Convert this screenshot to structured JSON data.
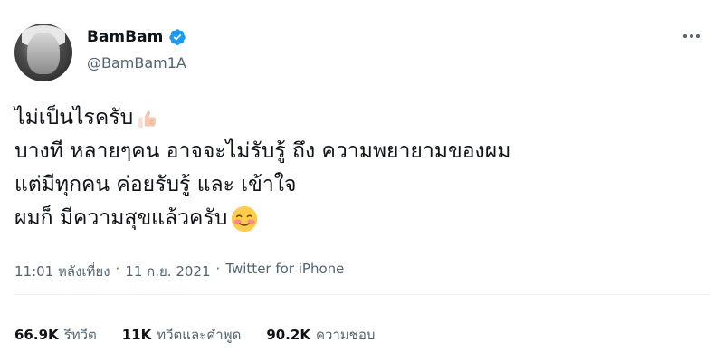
{
  "author": {
    "name": "BamBam",
    "handle": "@BamBam1A"
  },
  "tweet": {
    "lines": [
      "ไม่เป็นไรครับ",
      "บางที หลายๆคน อาจจะไม่รับรู้ ถึง ความพยายามของผม",
      "แต่มีทุกคน ค่อยรับรู้ และ เข้าใจ",
      "ผมก็ มีความสุขแล้วครับ"
    ],
    "emojis": [
      "thumbs-up-icon",
      "smiling-face-icon"
    ]
  },
  "meta": {
    "time": "11:01 หลังเที่ยง",
    "separator1": "·",
    "date": "11 ก.ย. 2021",
    "separator2": "·",
    "source": "Twitter for iPhone"
  },
  "stats": {
    "retweets_count": "66.9K",
    "retweets_label": "รีทวีต",
    "quotes_count": "11K",
    "quotes_label": "ทวีตและคำพูด",
    "likes_count": "90.2K",
    "likes_label": "ความชอบ"
  },
  "colors": {
    "verified": "#1d9bf0",
    "secondary_text": "#536471",
    "primary_text": "#0f1419"
  }
}
